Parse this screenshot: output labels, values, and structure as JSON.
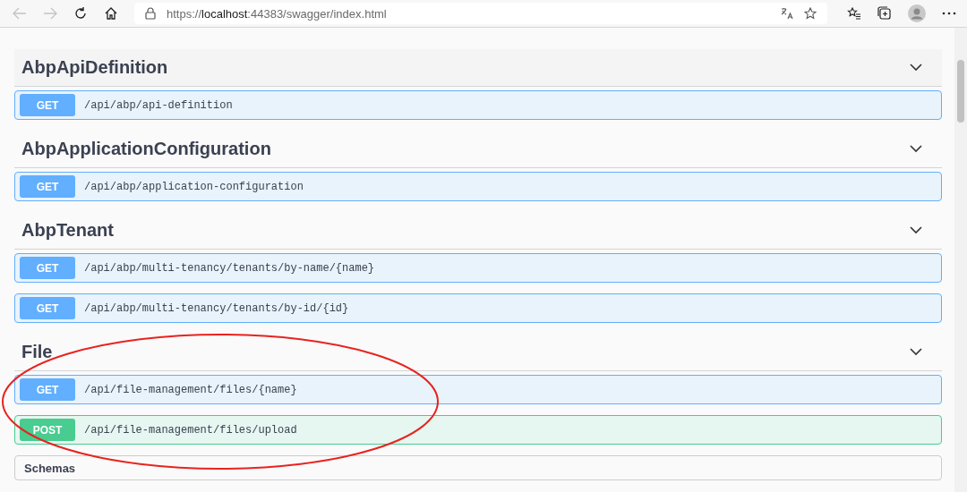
{
  "browser": {
    "url": "https://**localhost**:44383/swagger/index.html",
    "back_disabled": true,
    "forward_disabled": true
  },
  "sections": [
    {
      "title": "AbpApiDefinition",
      "expanded": true,
      "operations": [
        {
          "method": "GET",
          "path": "/api/abp/api-definition"
        }
      ]
    },
    {
      "title": "AbpApplicationConfiguration",
      "expanded": true,
      "operations": [
        {
          "method": "GET",
          "path": "/api/abp/application-configuration"
        }
      ]
    },
    {
      "title": "AbpTenant",
      "expanded": true,
      "operations": [
        {
          "method": "GET",
          "path": "/api/abp/multi-tenancy/tenants/by-name/{name}"
        },
        {
          "method": "GET",
          "path": "/api/abp/multi-tenancy/tenants/by-id/{id}"
        }
      ]
    },
    {
      "title": "File",
      "expanded": true,
      "operations": [
        {
          "method": "GET",
          "path": "/api/file-management/files/{name}"
        },
        {
          "method": "POST",
          "path": "/api/file-management/files/upload"
        }
      ]
    }
  ],
  "schemas": {
    "title": "Schemas"
  }
}
